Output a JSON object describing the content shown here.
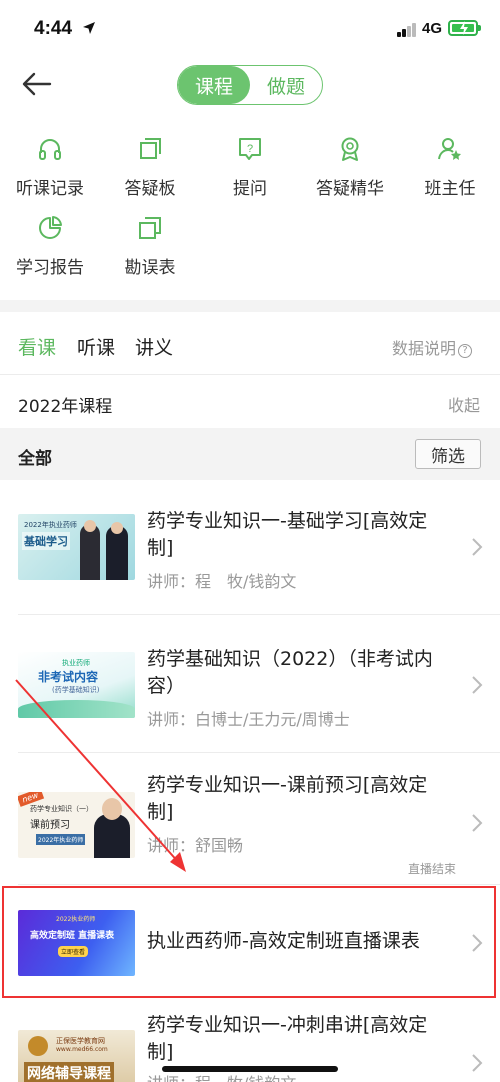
{
  "status_bar": {
    "time": "4:44",
    "network": "4G",
    "battery_color": "#35c04e"
  },
  "header": {
    "tabs": [
      {
        "label": "课程",
        "active": true
      },
      {
        "label": "做题",
        "active": false
      }
    ]
  },
  "tools": [
    {
      "label": "听课记录",
      "icon": "headphones-icon"
    },
    {
      "label": "答疑板",
      "icon": "board-icon"
    },
    {
      "label": "提问",
      "icon": "question-bubble-icon"
    },
    {
      "label": "答疑精华",
      "icon": "award-icon"
    },
    {
      "label": "班主任",
      "icon": "teacher-icon"
    },
    {
      "label": "学习报告",
      "icon": "report-icon"
    },
    {
      "label": "勘误表",
      "icon": "errata-icon"
    }
  ],
  "content_tabs": [
    {
      "label": "看课",
      "active": true
    },
    {
      "label": "听课",
      "active": false
    },
    {
      "label": "讲义",
      "active": false
    }
  ],
  "data_note": "数据说明",
  "year_section": {
    "label": "2022年课程",
    "collapse": "收起"
  },
  "filter_bar": {
    "label": "全部",
    "filter_button": "筛选"
  },
  "courses": [
    {
      "title": "药学专业知识一-基础学习[高效定制]",
      "teacher": "讲师：程　牧/钱韵文",
      "thumb_lines": [
        "2022年执业药师",
        "基础学习"
      ]
    },
    {
      "title": "药学基础知识（2022）（非考试内容）",
      "teacher": "讲师：白博士/王力元/周博士",
      "thumb_lines": [
        "执业药师",
        "非考试内容",
        "(药学基础知识)"
      ]
    },
    {
      "title": "药学专业知识一-课前预习[高效定制]",
      "teacher": "讲师：舒国畅",
      "status": "直播结束",
      "thumb_lines": [
        "new",
        "药学专业知识（一）",
        "课前预习",
        "2022年执业药师"
      ]
    },
    {
      "title": "执业西药师-高效定制班直播课表",
      "thumb_lines": [
        "2022执业药师",
        "高效定制班 直播课表",
        "立即查看"
      ]
    },
    {
      "title": "药学专业知识一-冲刺串讲[高效定制]",
      "teacher": "讲师：程　牧/钱韵文",
      "thumb_lines": [
        "正保医学教育网",
        "www.med66.com",
        "网络辅导课程"
      ]
    }
  ],
  "colors": {
    "accent": "#6cc46f",
    "annotation": "#ee3333"
  }
}
